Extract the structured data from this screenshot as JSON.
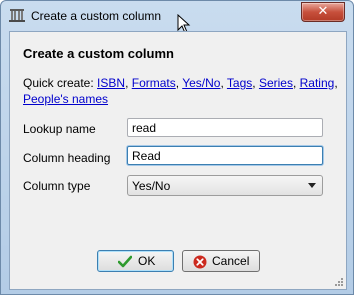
{
  "window": {
    "title": "Create a custom column",
    "close_glyph": "✕"
  },
  "icons": {
    "app": "calibre-library-icon",
    "close": "close-icon",
    "cursor": "mouse-pointer-icon",
    "ok": "checkmark-icon",
    "cancel": "cancel-icon",
    "dropdown": "chevron-down-icon"
  },
  "dialog": {
    "heading": "Create a custom column",
    "quick_create_label": "Quick create:",
    "quick_links": [
      "ISBN",
      "Formats",
      "Yes/No",
      "Tags",
      "Series",
      "Rating",
      "People's names"
    ]
  },
  "form": {
    "lookup_name_label": "Lookup name",
    "lookup_name_value": "read",
    "column_heading_label": "Column heading",
    "column_heading_value": "Read",
    "column_type_label": "Column type",
    "column_type_value": "Yes/No"
  },
  "buttons": {
    "ok": "OK",
    "cancel": "Cancel"
  },
  "colors": {
    "link": "#0000cc",
    "title_bar": "#b9d1ea",
    "close_button": "#c7503c",
    "ok_icon": "#2e9a2e",
    "cancel_icon": "#cc2a1f"
  }
}
